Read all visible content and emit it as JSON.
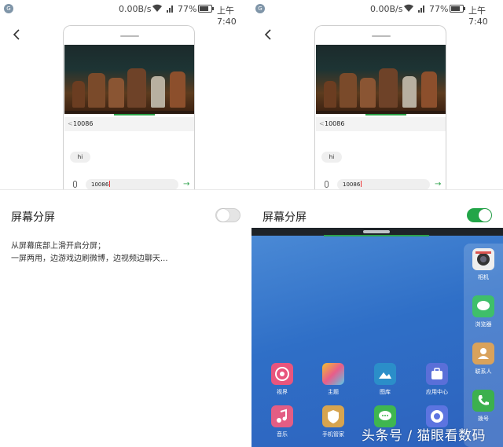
{
  "status": {
    "net_speed": "0.00B/s",
    "battery_pct": "77%",
    "time": "上午7:40"
  },
  "preview": {
    "contact": "10086",
    "message": "hi",
    "input_text": "10086"
  },
  "setting": {
    "title": "屏幕分屏",
    "description_line1": "从屏幕底部上滑开启分屏；",
    "description_line2": "一屏两用，边游戏边刷微博，边视频边聊天..."
  },
  "toggle_states": {
    "left": "off",
    "right": "on"
  },
  "colors": {
    "accent_green": "#22a548",
    "home_blue": "#2f6fc7"
  },
  "home": {
    "apps": [
      {
        "label": "视界",
        "icon": "video-icon",
        "color": "#e8557d"
      },
      {
        "label": "主题",
        "icon": "theme-icon",
        "color": "#f0c030"
      },
      {
        "label": "图库",
        "icon": "gallery-icon",
        "color": "#2b8ec9"
      },
      {
        "label": "应用中心",
        "icon": "app-center-icon",
        "color": "#5a6fd8"
      },
      {
        "label": "音乐",
        "icon": "music-icon",
        "color": "#e35d84"
      },
      {
        "label": "手机管家",
        "icon": "shield-icon",
        "color": "#d7a44f"
      },
      {
        "label": "",
        "icon": "message-icon",
        "color": "#3fb650"
      },
      {
        "label": "",
        "icon": "compass-icon",
        "color": "#5c74e0"
      }
    ],
    "dock": [
      {
        "label": "相机",
        "icon": "camera-icon"
      },
      {
        "label": "浏览器",
        "icon": "browser-icon"
      },
      {
        "label": "联系人",
        "icon": "contacts-icon"
      },
      {
        "label": "拨号",
        "icon": "phone-icon"
      }
    ]
  },
  "watermark": "头条号 / 猫眼看数码"
}
